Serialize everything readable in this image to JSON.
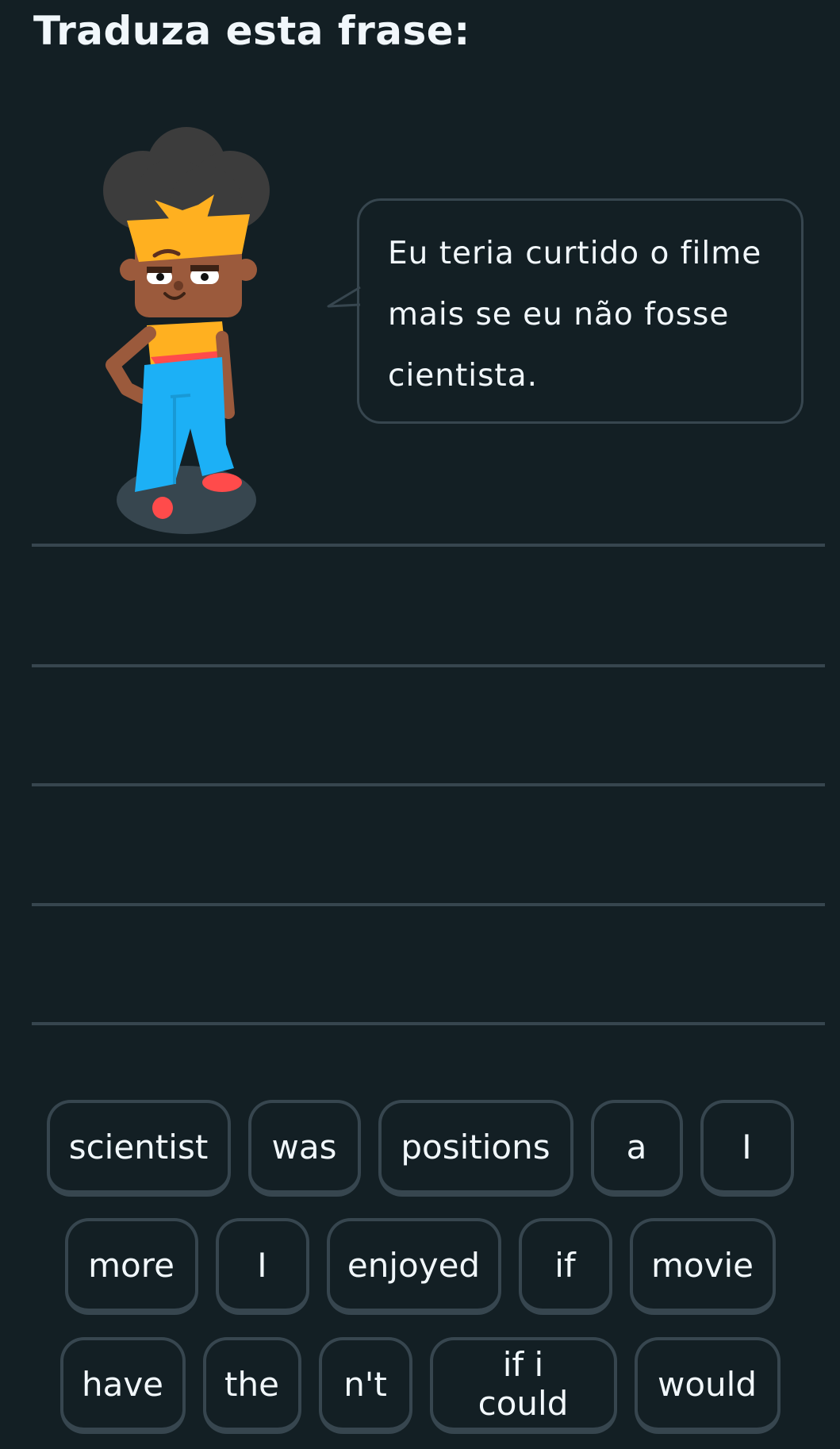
{
  "header": {
    "title": "Traduza esta frase:"
  },
  "prompt": {
    "lines": [
      "Eu teria curtido o filme",
      "mais se eu não fosse",
      "cientista."
    ]
  },
  "word_bank": {
    "rows": [
      [
        "scientist",
        "was",
        "positions",
        "a",
        "I"
      ],
      [
        "more",
        "I",
        "enjoyed",
        "if",
        "movie"
      ],
      [
        "have",
        "the",
        "n't",
        "if i could",
        "would"
      ]
    ]
  },
  "colors": {
    "background": "#131f24",
    "border": "#37464f",
    "text": "#f1f7fb",
    "shirt": "#ffb020",
    "pants": "#1cb0f6",
    "shoes": "#ff4b4b",
    "skin": "#9b5a3c",
    "hair": "#3c3c3c"
  }
}
